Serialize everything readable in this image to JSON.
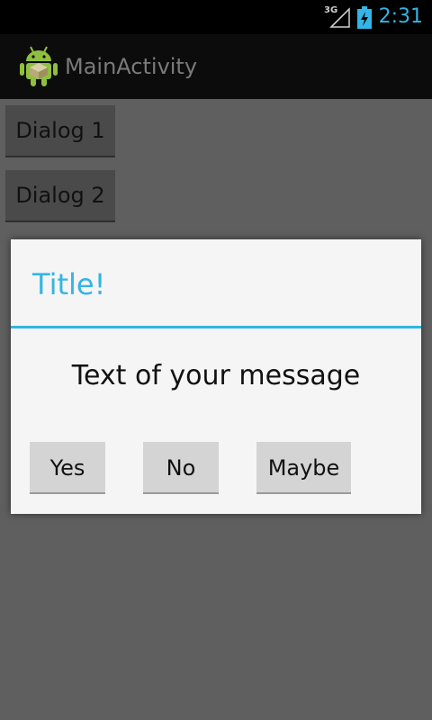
{
  "status_bar": {
    "network_label": "3G",
    "clock": "2:31",
    "icons": [
      "signal-icon",
      "battery-charging-icon"
    ],
    "accent_color": "#33b5e5"
  },
  "action_bar": {
    "app_icon": "android-robot-icon",
    "title": "MainActivity"
  },
  "main": {
    "buttons": [
      {
        "label": "Dialog 1"
      },
      {
        "label": "Dialog 2"
      }
    ]
  },
  "dialog": {
    "title": "Title!",
    "message": "Text of your message",
    "buttons": {
      "yes": "Yes",
      "no": "No",
      "maybe": "Maybe"
    }
  }
}
